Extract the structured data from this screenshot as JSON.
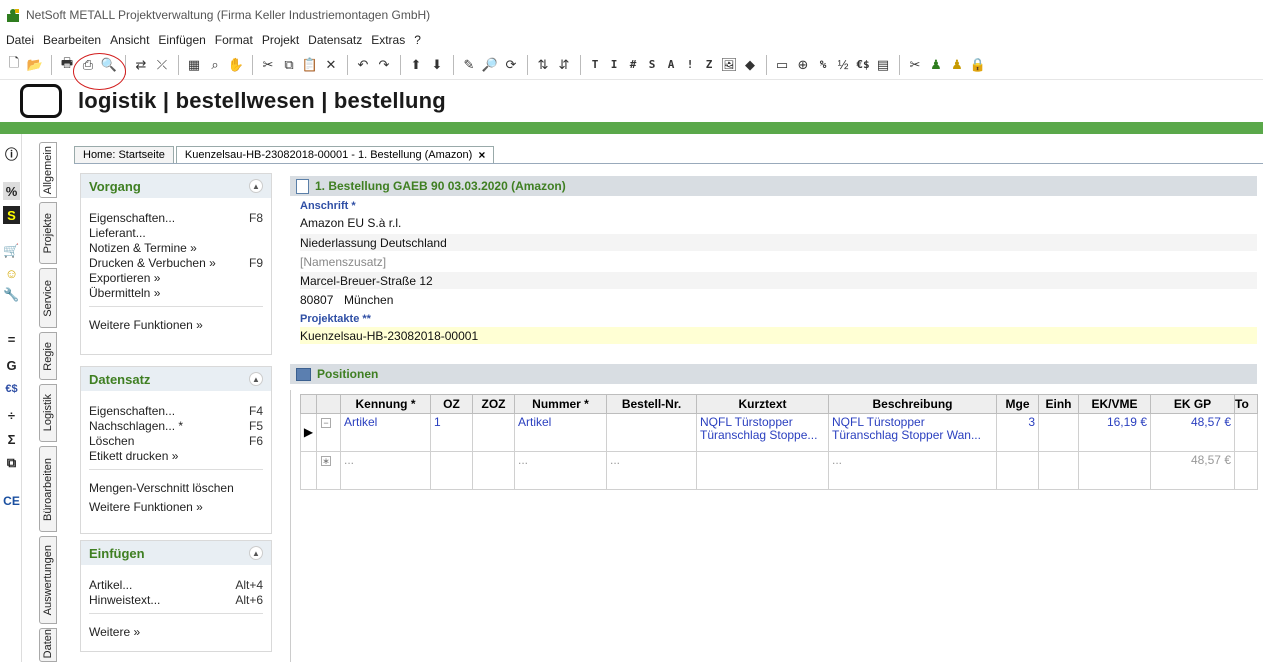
{
  "window": {
    "title": "NetSoft METALL Projektverwaltung (Firma Keller Industriemontagen GmbH)"
  },
  "menu": [
    "Datei",
    "Bearbeiten",
    "Ansicht",
    "Einfügen",
    "Format",
    "Projekt",
    "Datensatz",
    "Extras",
    "?"
  ],
  "toolbar": {
    "text_buttons": [
      "T",
      "I",
      "#",
      "S",
      "A",
      "!",
      "Z"
    ],
    "percent": "%",
    "euro": "€$"
  },
  "header": {
    "heading": "logistik | bestellwesen | bestellung"
  },
  "side_icons": [
    "info-icon",
    "percent-icon",
    "s-icon",
    "cart-icon",
    "smiley-icon",
    "wrench-icon",
    "equals-icon",
    "g-icon",
    "euro-icon",
    "divide-icon",
    "sigma-icon",
    "tree-icon",
    "ce-icon"
  ],
  "side_labels": {
    "g": "G",
    "euro": "€$",
    "sigma": "Σ",
    "ce": "CE",
    "s": "S",
    "divide": "÷",
    "equals": "=",
    "percent": "%"
  },
  "vtabs": [
    "Allgemein",
    "Projekte",
    "Service",
    "Regie",
    "Logistik",
    "Büroarbeiten",
    "Auswertungen",
    "Daten"
  ],
  "doc_tabs": {
    "home": "Home: Startseite",
    "active": "Kuenzelsau-HB-23082018-00001 - 1. Bestellung (Amazon)",
    "close": "×"
  },
  "left_panel": {
    "vorgang": {
      "title": "Vorgang",
      "items": [
        {
          "label": "Eigenschaften...",
          "key": "F8"
        },
        {
          "label": "Lieferant...",
          "key": ""
        },
        {
          "label": "Notizen & Termine »",
          "key": ""
        },
        {
          "label": "Drucken & Verbuchen »",
          "key": "F9"
        },
        {
          "label": "Exportieren »",
          "key": ""
        },
        {
          "label": "Übermitteln »",
          "key": ""
        }
      ],
      "more": "Weitere Funktionen »"
    },
    "datensatz": {
      "title": "Datensatz",
      "items": [
        {
          "label": "Eigenschaften...",
          "key": "F4"
        },
        {
          "label": "Nachschlagen... *",
          "key": "F5"
        },
        {
          "label": "Löschen",
          "key": "F6"
        },
        {
          "label": "Etikett drucken »",
          "key": ""
        }
      ],
      "extra": "Mengen-Verschnitt löschen",
      "more": "Weitere Funktionen »"
    },
    "einfuegen": {
      "title": "Einfügen",
      "items": [
        {
          "label": "Artikel...",
          "key": "Alt+4"
        },
        {
          "label": "Hinweistext...",
          "key": "Alt+6"
        }
      ],
      "more": "Weitere »"
    }
  },
  "document": {
    "title": "1. Bestellung GAEB 90 03.03.2020 (Amazon)",
    "anschrift_label": "Anschrift *",
    "name1": "Amazon EU S.à r.l.",
    "name2": "Niederlassung Deutschland",
    "namenszusatz": "[Namenszusatz]",
    "street": "Marcel-Breuer-Straße 12",
    "zip": "80807",
    "city": "München",
    "projektakte_label": "Projektakte **",
    "projektakte": "Kuenzelsau-HB-23082018-00001"
  },
  "positions": {
    "title": "Positionen",
    "columns": [
      "Kennung *",
      "OZ",
      "ZOZ",
      "Nummer *",
      "Bestell-Nr.",
      "Kurztext",
      "Beschreibung",
      "Mge",
      "Einh",
      "EK/VME",
      "EK GP",
      "To"
    ],
    "rows": [
      {
        "kennung": "Artikel",
        "oz": "1",
        "zoz": "",
        "nummer": "Artikel",
        "bestellnr": "",
        "kurztext": "NQFL Türstopper Türanschlag Stoppe...",
        "kurztext_l1": "NQFL Türstopper",
        "kurztext_l2": "Türanschlag Stoppe...",
        "beschreibung_l1": "NQFL Türstopper",
        "beschreibung_l2": "Türanschlag Stopper Wan...",
        "mge": "3",
        "einh": "",
        "ek_vme": "16,19 €",
        "ek_gp": "48,57 €"
      },
      {
        "kennung": "...",
        "nummer": "...",
        "bestellnr": "...",
        "beschreibung_l1": "...",
        "ek_gp": "48,57 €"
      }
    ]
  }
}
